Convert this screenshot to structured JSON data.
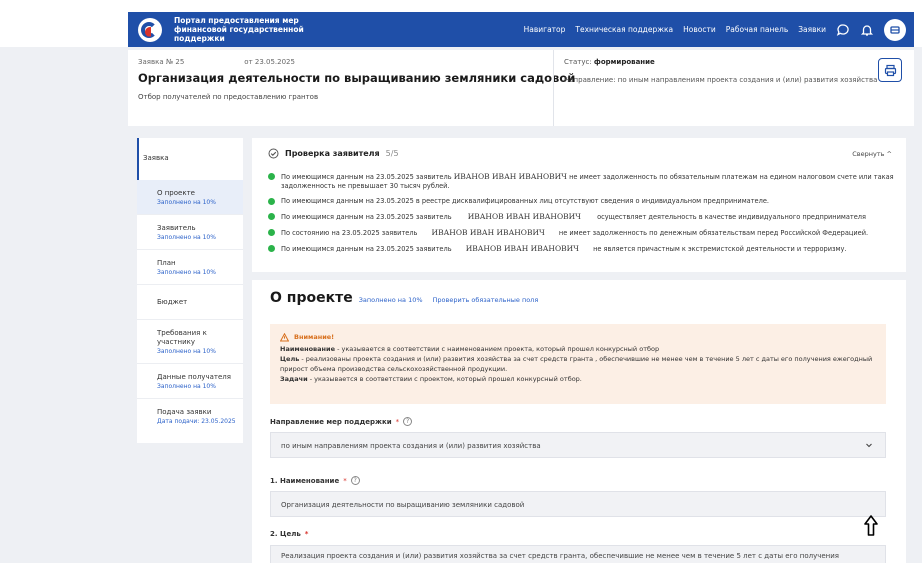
{
  "portal": {
    "name": "Портал предоставления мер финансовой государственной поддержки"
  },
  "nav": [
    "Навигатор",
    "Техническая поддержка",
    "Новости",
    "Рабочая панель",
    "Заявки"
  ],
  "icons": {
    "chat": "chat-icon",
    "bell": "bell-icon",
    "profile": "profile-icon",
    "print": "print-icon",
    "check": "check-circle-icon",
    "warning": "warning-icon",
    "chevron": "chevron-down-icon"
  },
  "header": {
    "number": "Заявка № 25",
    "date": "от 23.05.2025",
    "title": "Организация деятельности по выращиванию земляники садовой",
    "subtitle": "Отбор получателей по предоставлению грантов",
    "status_label": "Статус:",
    "status_value": "формирование",
    "direction": "Направление: по иным направлениям проекта создания и (или) развития хозяйства"
  },
  "sidebar": {
    "head": "Заявка",
    "items": [
      {
        "title": "О проекте",
        "progress": "Заполнено на 10%"
      },
      {
        "title": "Заявитель",
        "progress": "Заполнено на 10%"
      },
      {
        "title": "План",
        "progress": "Заполнено на 10%"
      },
      {
        "title": "Бюджет",
        "progress": ""
      },
      {
        "title": "Требования к участнику",
        "progress": "Заполнено на 10%"
      },
      {
        "title": "Данные получателя",
        "progress": "Заполнено на 10%"
      },
      {
        "title": "Подача заявки",
        "progress": "Дата подачи: 23.05.2025"
      }
    ]
  },
  "check": {
    "title": "Проверка заявителя",
    "count": "5/5",
    "collapse": "Свернуть",
    "items": [
      {
        "a": "По имеющимся данным на 23.05.2025 заявитель",
        "name": "ИВАНОВ ИВАН ИВАНОВИЧ",
        "b": "не имеет задолженность по обязательным платежам на едином налоговом счете или такая задолженность не превышает 30 тысяч рублей."
      },
      {
        "a": "По имеющимся данным на 23.05.2025 в реестре дисквалифицированных лиц отсутствуют сведения о индивидуальном предпринимателе.",
        "name": "",
        "b": ""
      },
      {
        "a": "По имеющимся данным на 23.05.2025 заявитель",
        "name": "ИВАНОВ ИВАН ИВАНОВИЧ",
        "b": "осуществляет деятельность в качестве индивидуального предпринимателя"
      },
      {
        "a": "По состоянию на 23.05.2025 заявитель",
        "name": "ИВАНОВ ИВАН ИВАНОВИЧ",
        "b": "не имеет задолженность по денежным обязательствам перед Российской Федерацией."
      },
      {
        "a": "По имеющимся данным на 23.05.2025 заявитель",
        "name": "ИВАНОВ ИВАН ИВАНОВИЧ",
        "b": "не является причастным к экстремистской деятельности и терроризму."
      }
    ]
  },
  "about": {
    "title": "О проекте",
    "filled": "Заполнено на 10%",
    "verify": "Проверить обязательные поля",
    "warning": {
      "title": "Внимание!",
      "l1_b": "Наименование",
      "l1": " - указывается в соответствии с наименованием проекта, который прошел конкурсный отбор",
      "l2_b": "Цель",
      "l2": " - реализованы проекта создания и (или) развития хозяйства за счет средств гранта , обеспечившие не менее чем в течение 5 лет с даты его получения ежегодный прирост объема производства сельскохозяйственной продукции.",
      "l3_b": "Задачи",
      "l3": " - указывается в соответствии с проектом, который прошел конкурсный отбор."
    },
    "fields": [
      {
        "label": "Направление мер поддержки",
        "value": "по иным направлениям проекта создания и (или) развития хозяйства"
      },
      {
        "label": "1. Наименование",
        "value": "Организация деятельности по выращиванию земляники садовой"
      },
      {
        "label": "2. Цель",
        "value": "Реализация проекта создания и (или) развития хозяйства за счет средств гранта, обеспечившие не менее чем в течение 5 лет с даты его получения"
      }
    ]
  }
}
